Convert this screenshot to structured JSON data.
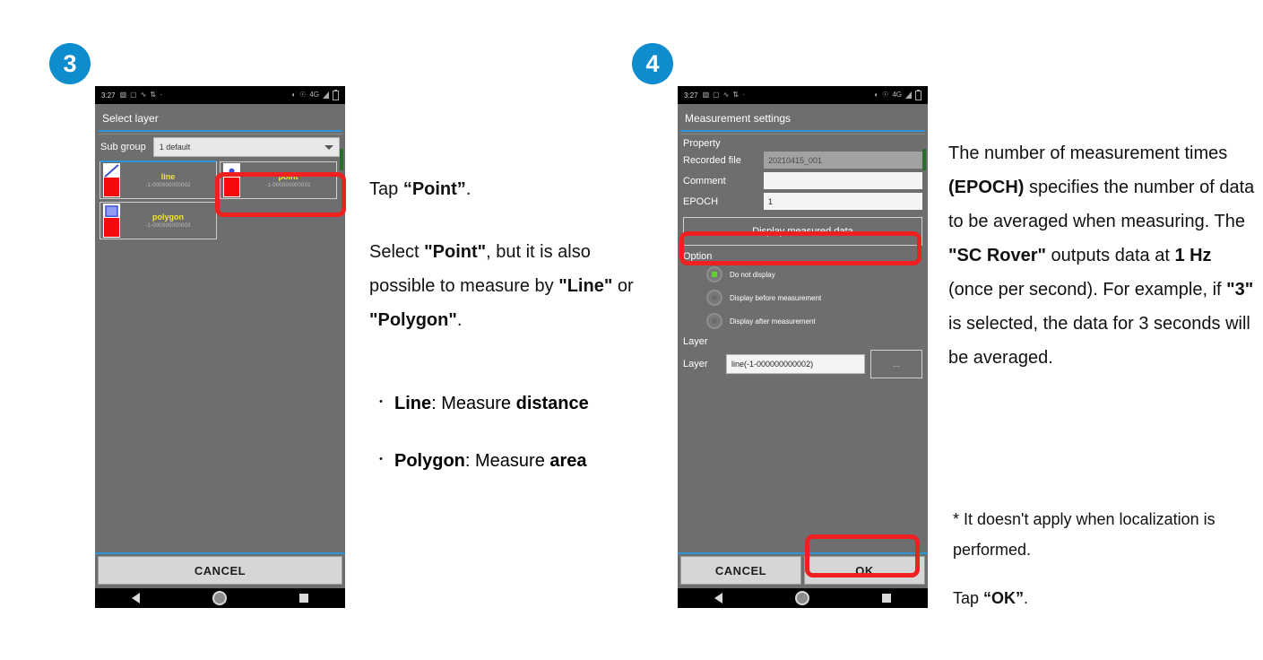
{
  "steps": {
    "three": "3",
    "four": "4"
  },
  "colors": {
    "badge_blue": "#0d8dcd",
    "highlight_red": "#f02020",
    "accent_blue": "#2f93d8",
    "layer_label_yellow": "#f2e532",
    "radio_green": "#5bd32a"
  },
  "phone_a": {
    "statusbar": {
      "time": "3:27",
      "left_icons": [
        "download-icon",
        "sim-icon",
        "activity-icon",
        "sync-icon",
        "dot-icon"
      ],
      "right_icons": [
        "brightness-icon",
        "alarm-icon",
        "4g-icon",
        "signal-icon",
        "battery-icon"
      ],
      "network": "4G"
    },
    "dialog": {
      "title": "Select layer",
      "subgroup_label": "Sub group",
      "subgroup_value": "1 default",
      "layers": [
        {
          "name": "line",
          "id": "-1-000000000002"
        },
        {
          "name": "point",
          "id": "-1-000000000001"
        },
        {
          "name": "polygon",
          "id": "-1-000000000003"
        }
      ],
      "cancel_label": "CANCEL"
    },
    "navbar": [
      "back-icon",
      "home-icon",
      "recents-icon"
    ]
  },
  "phone_b": {
    "statusbar": {
      "time": "3:27",
      "network": "4G"
    },
    "dialog": {
      "title": "Measurement settings",
      "property_label": "Property",
      "fields": [
        {
          "label": "Recorded file",
          "value": "20210415_001",
          "readonly": true
        },
        {
          "label": "Comment",
          "value": "",
          "readonly": false
        },
        {
          "label": "EPOCH",
          "value": "1",
          "readonly": false
        }
      ],
      "display_measured_button": "Display measured data",
      "option_label": "Option",
      "options": [
        {
          "label": "Do not display",
          "selected": true
        },
        {
          "label": "Display before measurement",
          "selected": false
        },
        {
          "label": "Display after measurement",
          "selected": false
        }
      ],
      "layer_section_label": "Layer",
      "layer_field_label": "Layer",
      "layer_value": "line(-1-000000000002)",
      "layer_button_label": "...",
      "cancel_label": "CANCEL",
      "ok_label": "OK"
    }
  },
  "prose_mid": {
    "line1_pre": "Tap ",
    "line1_strong": "“Point”",
    "line1_post": ".",
    "para2_a": "Select ",
    "para2_b": "\"Point\"",
    "para2_c": ", but it is also possible to measure by ",
    "para2_d": "\"Line\"",
    "para2_e": " or ",
    "para2_f": "\"Polygon\"",
    "para2_g": "."
  },
  "bullets": [
    {
      "marker": "・",
      "strong": "Line",
      "mid": ": Measure ",
      "strong2": "distance"
    },
    {
      "marker": "・",
      "strong": "Polygon",
      "mid": ": Measure ",
      "strong2": "area"
    }
  ],
  "prose_right": {
    "seg1": "The number of measurement times ",
    "seg2": "(EPOCH)",
    "seg3": " specifies the number of data to be averaged when measuring. The ",
    "seg4": "\"SC Rover\"",
    "seg5": " outputs data at ",
    "seg6": "1 Hz",
    "seg7": " (once per second). For example, if ",
    "seg8": "\"3\"",
    "seg9": " is selected, the data for 3 seconds will be averaged."
  },
  "prose_note": {
    "note": "* It doesn't apply when localization is performed.",
    "tap_pre": "Tap ",
    "tap_strong": "“OK”",
    "tap_post": "."
  }
}
